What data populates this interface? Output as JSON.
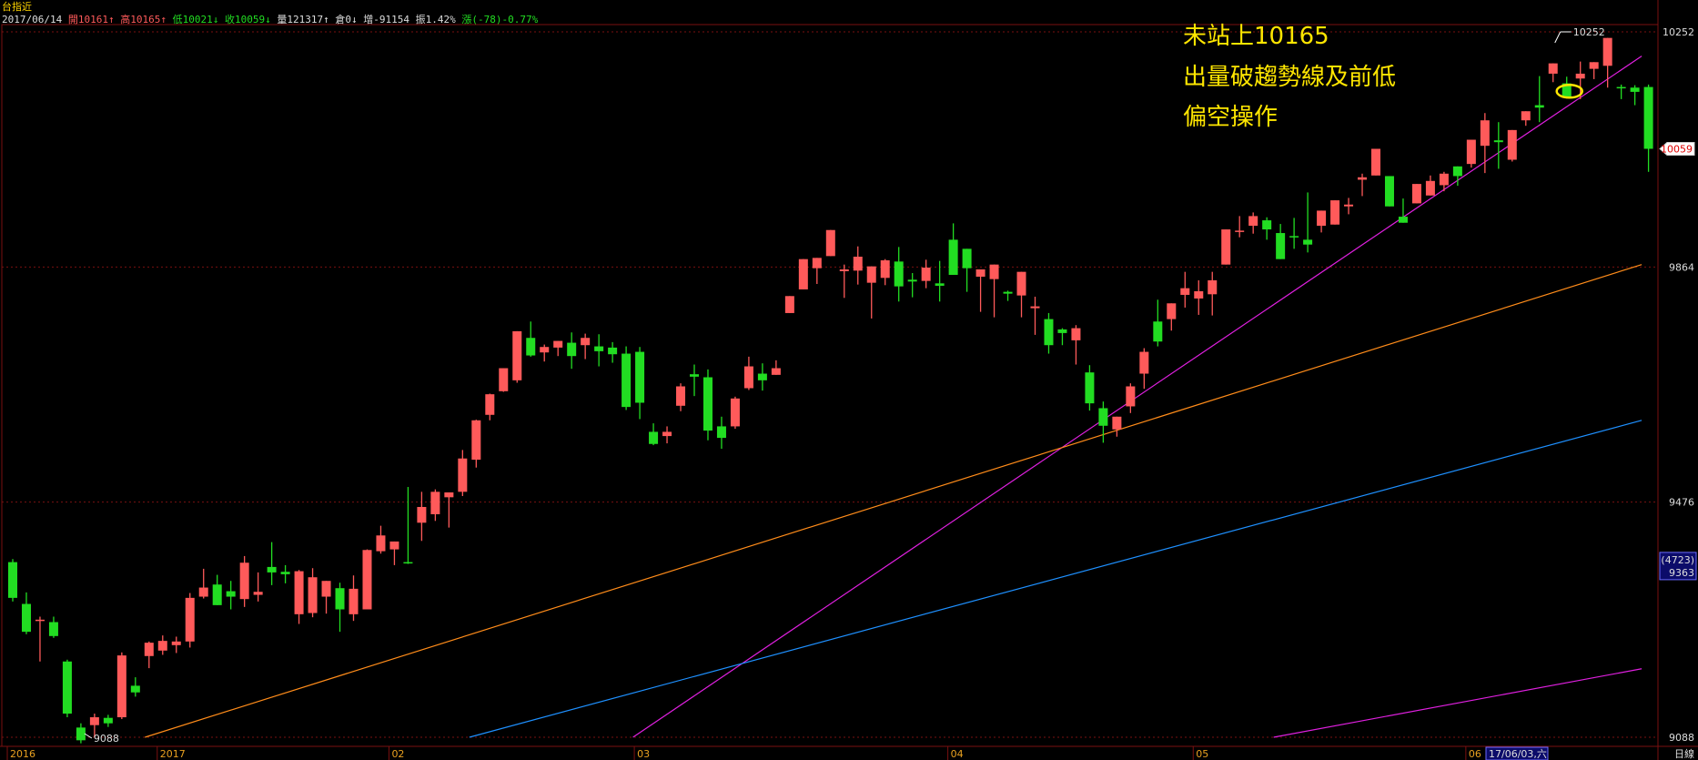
{
  "window_title": "台指近",
  "header": {
    "date": "2017/06/14",
    "open": "開10161",
    "high": "高10165",
    "low": "低10021",
    "close": "收10059",
    "volume": "量121317",
    "oi": "倉0",
    "oi_change": "增-91154",
    "amplitude": "振1.42%",
    "change": "漲(-78)-0.77%"
  },
  "annotations": [
    "未站上10165",
    "出量破趨勢線及前低",
    "偏空操作"
  ],
  "right_axis": {
    "current_price": "10059",
    "cursor_count": "(4723)",
    "cursor_price": "9363",
    "period_label": "日線"
  },
  "bottom_axis": {
    "cursor_date": "17/06/03,六"
  },
  "colors": {
    "up": "#ff5a5a",
    "down": "#22dd22",
    "trend_magenta": "#e020e0",
    "trend_orange": "#ff8c1a",
    "trend_blue": "#1e90ff",
    "grid": "#7a1010",
    "axis_text": "#dddddd",
    "annotation": "#ffe600",
    "highlight_ellipse": "#ffe600"
  },
  "chart_data": {
    "type": "candlestick",
    "title": "台指近",
    "yticks": [
      9088,
      9476,
      9864,
      10252
    ],
    "ylim": [
      9088,
      10268
    ],
    "date_ticks": [
      {
        "label": "2016",
        "index": 0
      },
      {
        "label": "2017",
        "index": 11
      },
      {
        "label": "02",
        "index": 28
      },
      {
        "label": "03",
        "index": 46
      },
      {
        "label": "04",
        "index": 69
      },
      {
        "label": "05",
        "index": 87
      },
      {
        "label": "06",
        "index": 107
      }
    ],
    "low_marker": {
      "label": "9088",
      "index": 5,
      "price": 9088
    },
    "high_marker": {
      "label": "10252",
      "index": 113,
      "price": 10252
    },
    "candles": [
      [
        9377,
        9382,
        9312,
        9318
      ],
      [
        9308,
        9327,
        9258,
        9262
      ],
      [
        9280,
        9287,
        9213,
        9282
      ],
      [
        9278,
        9287,
        9252,
        9255
      ],
      [
        9213,
        9216,
        9121,
        9127
      ],
      [
        9104,
        9111,
        9078,
        9083
      ],
      [
        9108,
        9127,
        9088,
        9121
      ],
      [
        9120,
        9125,
        9105,
        9111
      ],
      [
        9121,
        9228,
        9118,
        9223
      ],
      [
        9173,
        9187,
        9155,
        9162
      ],
      [
        9222,
        9246,
        9202,
        9244
      ],
      [
        9231,
        9256,
        9224,
        9247
      ],
      [
        9240,
        9254,
        9227,
        9246
      ],
      [
        9246,
        9326,
        9236,
        9318
      ],
      [
        9320,
        9366,
        9317,
        9335
      ],
      [
        9340,
        9356,
        9312,
        9306
      ],
      [
        9329,
        9346,
        9299,
        9320
      ],
      [
        9316,
        9387,
        9303,
        9376
      ],
      [
        9323,
        9360,
        9312,
        9328
      ],
      [
        9369,
        9410,
        9339,
        9360
      ],
      [
        9361,
        9372,
        9342,
        9357
      ],
      [
        9291,
        9364,
        9275,
        9362
      ],
      [
        9293,
        9367,
        9286,
        9352
      ],
      [
        9320,
        9341,
        9292,
        9346
      ],
      [
        9334,
        9343,
        9262,
        9299
      ],
      [
        9291,
        9355,
        9280,
        9333
      ],
      [
        9299,
        9398,
        9299,
        9397
      ],
      [
        9395,
        9437,
        9391,
        9421
      ],
      [
        9398,
        9408,
        9372,
        9411
      ],
      [
        9377,
        9501,
        9374,
        9376
      ],
      [
        9442,
        9493,
        9412,
        9468
      ],
      [
        9456,
        9497,
        9445,
        9493
      ],
      [
        9484,
        9492,
        9434,
        9492
      ],
      [
        9493,
        9562,
        9486,
        9548
      ],
      [
        9546,
        9612,
        9533,
        9611
      ],
      [
        9620,
        9655,
        9611,
        9654
      ],
      [
        9659,
        9696,
        9658,
        9697
      ],
      [
        9677,
        9723,
        9673,
        9758
      ],
      [
        9747,
        9774,
        9716,
        9718
      ],
      [
        9723,
        9736,
        9708,
        9732
      ],
      [
        9731,
        9741,
        9717,
        9742
      ],
      [
        9739,
        9756,
        9696,
        9717
      ],
      [
        9735,
        9754,
        9712,
        9747
      ],
      [
        9733,
        9753,
        9700,
        9725
      ],
      [
        9731,
        9740,
        9706,
        9720
      ],
      [
        9721,
        9733,
        9628,
        9633
      ],
      [
        9724,
        9732,
        9613,
        9640
      ],
      [
        9592,
        9606,
        9570,
        9572
      ],
      [
        9585,
        9601,
        9573,
        9592
      ],
      [
        9635,
        9672,
        9626,
        9667
      ],
      [
        9687,
        9703,
        9651,
        9683
      ],
      [
        9682,
        9695,
        9578,
        9594
      ],
      [
        9601,
        9617,
        9564,
        9582
      ],
      [
        9601,
        9650,
        9597,
        9647
      ],
      [
        9664,
        9716,
        9661,
        9700
      ],
      [
        9688,
        9705,
        9660,
        9677
      ],
      [
        9686,
        9710,
        9689,
        9697
      ],
      [
        9788,
        9792,
        9798,
        9816
      ],
      [
        9827,
        9877,
        9833,
        9877
      ],
      [
        9862,
        9870,
        9836,
        9879
      ],
      [
        9882,
        9906,
        9889,
        9925
      ],
      [
        9857,
        9868,
        9813,
        9860
      ],
      [
        9858,
        9898,
        9835,
        9881
      ],
      [
        9838,
        9846,
        9779,
        9865
      ],
      [
        9846,
        9877,
        9834,
        9875
      ],
      [
        9873,
        9897,
        9807,
        9832
      ],
      [
        9843,
        9854,
        9814,
        9840
      ],
      [
        9841,
        9876,
        9829,
        9863
      ],
      [
        9837,
        9874,
        9807,
        9833
      ],
      [
        9909,
        9936,
        9855,
        9851
      ],
      [
        9894,
        9888,
        9823,
        9862
      ],
      [
        9848,
        9840,
        9790,
        9860
      ],
      [
        9844,
        9861,
        9781,
        9868
      ],
      [
        9823,
        9825,
        9808,
        9820
      ],
      [
        9817,
        9835,
        9781,
        9856
      ],
      [
        9796,
        9815,
        9752,
        9799
      ],
      [
        9778,
        9788,
        9721,
        9735
      ],
      [
        9761,
        9763,
        9735,
        9755
      ],
      [
        9743,
        9768,
        9703,
        9763
      ],
      [
        9690,
        9702,
        9627,
        9639
      ],
      [
        9631,
        9642,
        9574,
        9602
      ],
      [
        9596,
        9616,
        9584,
        9617
      ],
      [
        9634,
        9672,
        9623,
        9667
      ],
      [
        9688,
        9730,
        9663,
        9724
      ],
      [
        9774,
        9810,
        9733,
        9741
      ],
      [
        9778,
        9795,
        9759,
        9804
      ],
      [
        9818,
        9856,
        9797,
        9829
      ],
      [
        9812,
        9842,
        9785,
        9824
      ],
      [
        9819,
        9856,
        9784,
        9842
      ],
      [
        9868,
        9912,
        9878,
        9926
      ],
      [
        9922,
        9948,
        9913,
        9924
      ],
      [
        9932,
        9954,
        9919,
        9948
      ],
      [
        9941,
        9946,
        9909,
        9926
      ],
      [
        9920,
        9935,
        9879,
        9877
      ],
      [
        9915,
        9945,
        9894,
        9914
      ],
      [
        9909,
        9987,
        9888,
        9901
      ],
      [
        9932,
        9957,
        9921,
        9957
      ],
      [
        9934,
        9962,
        9940,
        9974
      ],
      [
        9964,
        9978,
        9951,
        9967
      ],
      [
        10008,
        10018,
        9981,
        10012
      ],
      [
        10015,
        10037,
        10026,
        10059
      ],
      [
        10014,
        10010,
        9985,
        9964
      ],
      [
        9947,
        9977,
        9965,
        9937
      ],
      [
        9969,
        10001,
        9979,
        10001
      ],
      [
        9982,
        10015,
        9983,
        10006
      ],
      [
        9999,
        10021,
        9989,
        10018
      ],
      [
        10030,
        10028,
        9998,
        10014
      ],
      [
        10034,
        10054,
        10028,
        10074
      ],
      [
        10064,
        10118,
        10019,
        10106
      ],
      [
        10073,
        10103,
        10026,
        10070
      ],
      [
        10041,
        10089,
        10038,
        10090
      ],
      [
        10106,
        10115,
        10097,
        10121
      ],
      [
        10131,
        10179,
        10103,
        10127
      ],
      [
        10183,
        10199,
        10169,
        10200
      ],
      [
        10167,
        10178,
        10142,
        10143
      ],
      [
        10175,
        10203,
        10141,
        10183
      ],
      [
        10191,
        10202,
        10174,
        10202
      ],
      [
        10196,
        10226,
        10160,
        10242
      ],
      [
        10161,
        10165,
        10141,
        10159
      ],
      [
        10160,
        10164,
        10131,
        10153
      ],
      [
        10161,
        10165,
        10021,
        10059
      ]
    ],
    "trendlines": [
      {
        "color_key": "trend_magenta",
        "from": {
          "index": 45.5,
          "price": 9088
        },
        "to": {
          "index": 119.5,
          "price": 10212
        }
      },
      {
        "color_key": "trend_orange",
        "from": {
          "index": 9.7,
          "price": 9088
        },
        "to": {
          "index": 119.5,
          "price": 9868
        }
      },
      {
        "color_key": "trend_blue",
        "from": {
          "index": 33.5,
          "price": 9088
        },
        "to": {
          "index": 119.5,
          "price": 9611
        }
      },
      {
        "color_key": "trend_magenta",
        "from": {
          "index": 92.5,
          "price": 9088
        },
        "to": {
          "index": 119.5,
          "price": 9201
        }
      }
    ],
    "highlight": {
      "index": 114.2,
      "price": 10154
    }
  }
}
